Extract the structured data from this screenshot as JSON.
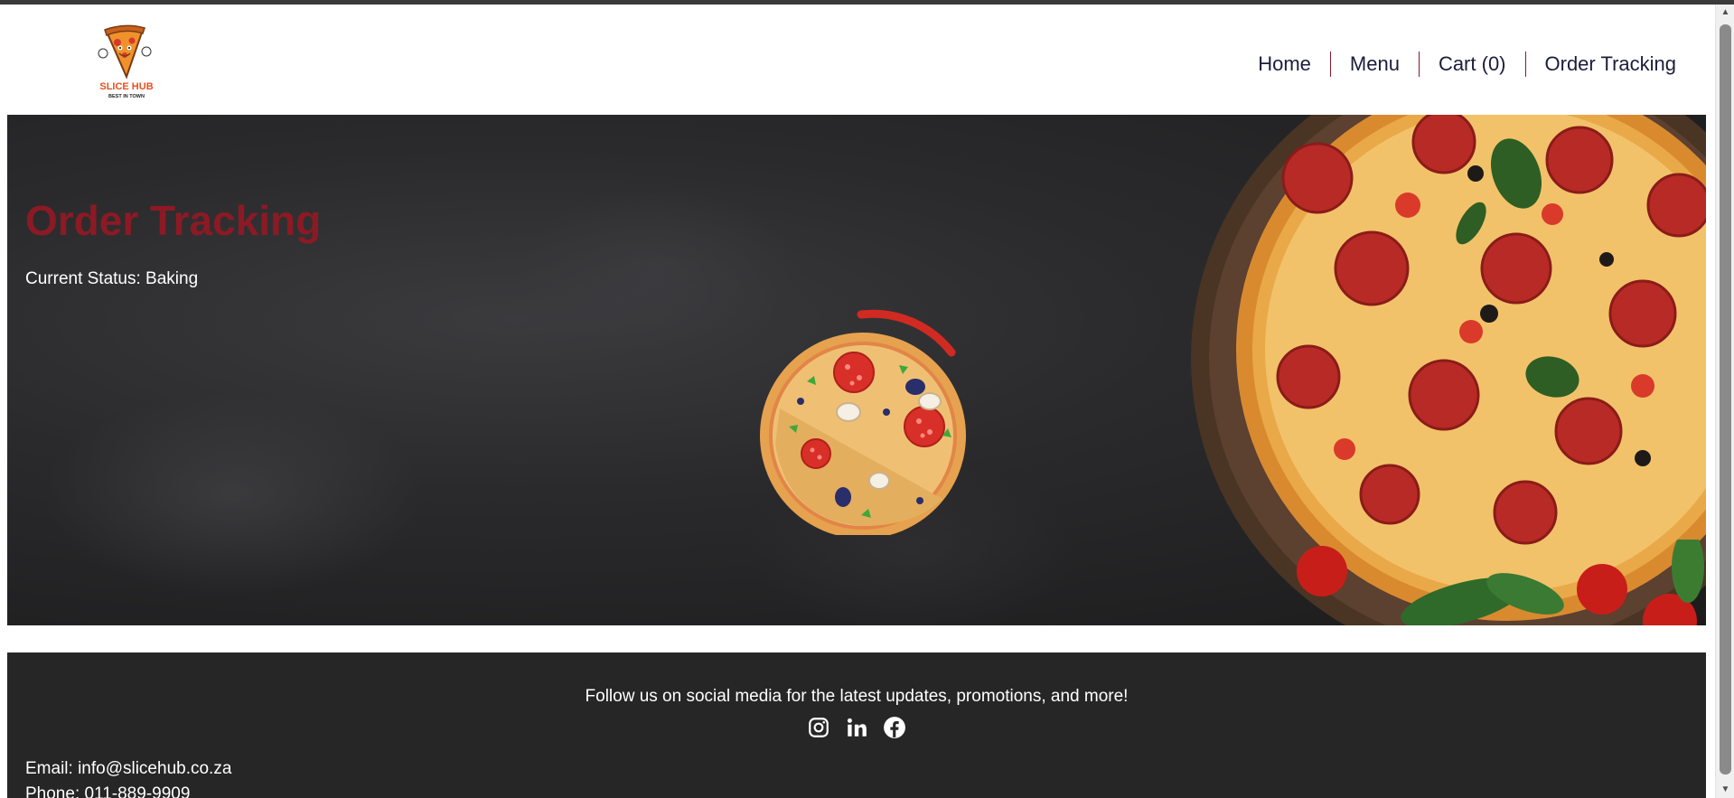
{
  "brand": {
    "logo_text": "SLICE HUB",
    "logo_tagline": "BEST IN TOWN",
    "accent_color": "#8b1a24"
  },
  "nav": {
    "items": [
      {
        "label": "Home"
      },
      {
        "label": "Menu"
      },
      {
        "label": "Cart (0)"
      },
      {
        "label": "Order Tracking"
      }
    ]
  },
  "hero": {
    "title": "Order Tracking",
    "status": "Current Status: Baking"
  },
  "footer": {
    "follow_text": "Follow us on social media for the latest updates, promotions, and more!",
    "socials": [
      "instagram-icon",
      "linkedin-icon",
      "facebook-icon"
    ],
    "email": "Email: info@slicehub.co.za",
    "phone": "Phone: 011-889-9909"
  }
}
